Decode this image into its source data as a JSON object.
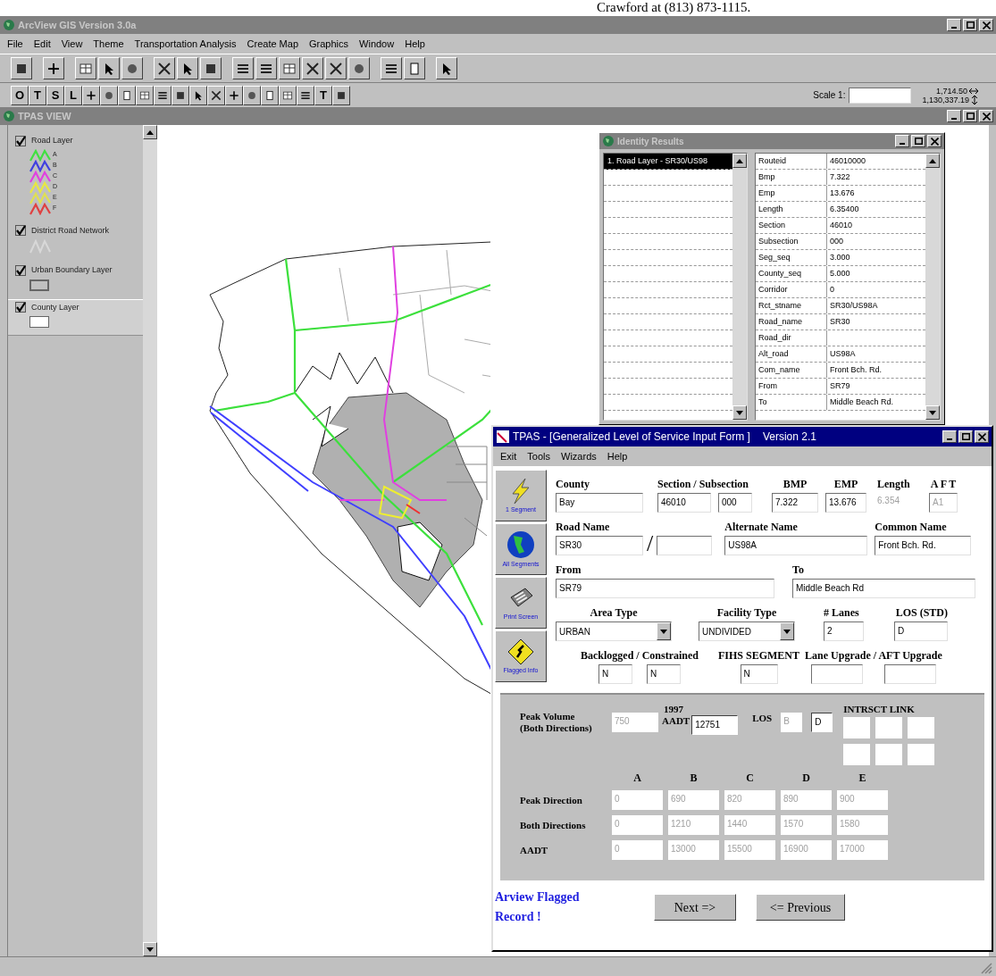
{
  "document_line": "Crawford at (813) 873-1115.",
  "app_title": "ArcView GIS Version 3.0a",
  "menu": [
    "File",
    "Edit",
    "View",
    "Theme",
    "Transportation Analysis",
    "Create Map",
    "Graphics",
    "Window",
    "Help"
  ],
  "tool_bar": [
    {
      "kind": "text",
      "label": "O"
    },
    {
      "kind": "text",
      "label": "T"
    },
    {
      "kind": "text",
      "label": "S"
    },
    {
      "kind": "text",
      "label": "L"
    },
    {
      "kind": "icon"
    },
    {
      "kind": "icon"
    },
    {
      "kind": "icon"
    },
    {
      "kind": "icon"
    },
    {
      "kind": "icon"
    },
    {
      "kind": "icon"
    },
    {
      "kind": "icon"
    },
    {
      "kind": "icon"
    },
    {
      "kind": "icon"
    },
    {
      "kind": "icon"
    },
    {
      "kind": "icon"
    },
    {
      "kind": "icon"
    },
    {
      "kind": "icon"
    },
    {
      "kind": "text",
      "label": "T"
    },
    {
      "kind": "icon"
    }
  ],
  "scale": {
    "label": "Scale 1:",
    "readouts": [
      "1,714.50",
      "1,130,337.19"
    ]
  },
  "view_title": "TPAS VIEW",
  "legend": [
    {
      "kind": "classes",
      "name": "Road Layer",
      "checked": true,
      "selected": false,
      "classes": [
        {
          "label": "A",
          "color": "#40e040"
        },
        {
          "label": "B",
          "color": "#4040e0"
        },
        {
          "label": "C",
          "color": "#e040e0"
        },
        {
          "label": "D",
          "color": "#e8e840"
        },
        {
          "label": "E",
          "color": "#e0e050"
        },
        {
          "label": "F",
          "color": "#e04040"
        }
      ]
    },
    {
      "kind": "line",
      "name": "District Road Network",
      "checked": true,
      "selected": false
    },
    {
      "kind": "outline_box",
      "name": "Urban Boundary Layer",
      "checked": true,
      "selected": false
    },
    {
      "kind": "white_box",
      "name": "County Layer",
      "checked": true,
      "selected": true
    }
  ],
  "identity": {
    "title": "Identity Results",
    "results": [
      {
        "label": "1. Road Layer - SR30/US98",
        "selected": true
      }
    ],
    "attributes": [
      {
        "field": "Routeid",
        "value": "46010000"
      },
      {
        "field": "Bmp",
        "value": "7.322"
      },
      {
        "field": "Emp",
        "value": "13.676"
      },
      {
        "field": "Length",
        "value": "6.35400"
      },
      {
        "field": "Section",
        "value": "46010"
      },
      {
        "field": "Subsection",
        "value": "000"
      },
      {
        "field": "Seg_seq",
        "value": "3.000"
      },
      {
        "field": "County_seq",
        "value": "5.000"
      },
      {
        "field": "Corridor",
        "value": "0"
      },
      {
        "field": "Rct_stname",
        "value": "SR30/US98A"
      },
      {
        "field": "Road_name",
        "value": "SR30"
      },
      {
        "field": "Road_dir"
      },
      {
        "field": "Alt_road",
        "value": "US98A"
      },
      {
        "field": "Com_name",
        "value": "Front Bch. Rd."
      },
      {
        "field": "From",
        "value": "SR79"
      },
      {
        "field": "To",
        "value": "Middle Beach Rd."
      }
    ]
  },
  "tpas": {
    "title": "TPAS - [Generalized Level of Service Input Form ]",
    "version": "Version 2.1",
    "menu": [
      "Exit",
      "Tools",
      "Wizards",
      "Help"
    ],
    "side_buttons": [
      {
        "kind": "bolt",
        "caption": "1 Segment"
      },
      {
        "kind": "globe",
        "caption": "All Segments"
      },
      {
        "kind": "printer",
        "caption": "Print Screen"
      },
      {
        "kind": "sign",
        "caption": "Flagged Info"
      }
    ],
    "form": {
      "county": {
        "label": "County",
        "value": "Bay"
      },
      "section": {
        "label": "Section / Subsection",
        "values": [
          "46010",
          "000"
        ]
      },
      "bmp": {
        "label": "BMP",
        "value": "7.322"
      },
      "emp": {
        "label": "EMP",
        "value": "13.676"
      },
      "length": {
        "label": "Length",
        "value": "6.354",
        "disabled": true
      },
      "aft": {
        "label": "A F T",
        "value": "A1",
        "disabled": true
      },
      "road_name": {
        "label": "Road Name",
        "value": "SR30",
        "separator": "/"
      },
      "alternate_name": {
        "label": "Alternate Name",
        "value": "US98A"
      },
      "common_name": {
        "label": "Common Name",
        "value": "Front Bch. Rd."
      },
      "from": {
        "label": "From",
        "value": "SR79"
      },
      "to": {
        "label": "To",
        "value": "Middle Beach Rd"
      },
      "area_type": {
        "label": "Area Type",
        "value": "URBAN"
      },
      "facility_type": {
        "label": "Facility Type",
        "value": "UNDIVIDED"
      },
      "lanes": {
        "label": "# Lanes",
        "value": "2"
      },
      "los_std": {
        "label": "LOS (STD)",
        "value": "D"
      },
      "backlogged": {
        "label": "Backlogged / Constrained",
        "values": [
          "N",
          "N"
        ]
      },
      "fihs": {
        "label": "FIHS SEGMENT",
        "value": "N"
      },
      "upgrade": {
        "label": "Lane Upgrade / AFT Upgrade"
      }
    },
    "panel": {
      "year": "1997",
      "volume_label": [
        "Peak Volume",
        "(Both Directions)"
      ],
      "volume": {
        "value": "750",
        "disabled": true
      },
      "aadt": {
        "label": "AADT",
        "value": "12751",
        "disabled": false
      },
      "los": {
        "label": "LOS",
        "value": "B",
        "disabled": true
      },
      "los_box": {
        "value": "D",
        "disabled": false
      },
      "link_label": "INTRSCT LINK",
      "columns": [
        "A",
        "B",
        "C",
        "D",
        "E"
      ],
      "rows": [
        {
          "label": "Peak Direction",
          "values": [
            "0",
            "690",
            "820",
            "890",
            "900"
          ],
          "disabled": true
        },
        {
          "label": "Both Directions",
          "values": [
            "0",
            "1210",
            "1440",
            "1570",
            "1580"
          ],
          "disabled": true
        },
        {
          "label": "AADT",
          "values": [
            "0",
            "13000",
            "15500",
            "16900",
            "17000"
          ],
          "disabled": true
        }
      ]
    },
    "flagged": "Arview Flagged Record !",
    "buttons": [
      "Next =>",
      "<= Previous"
    ]
  }
}
